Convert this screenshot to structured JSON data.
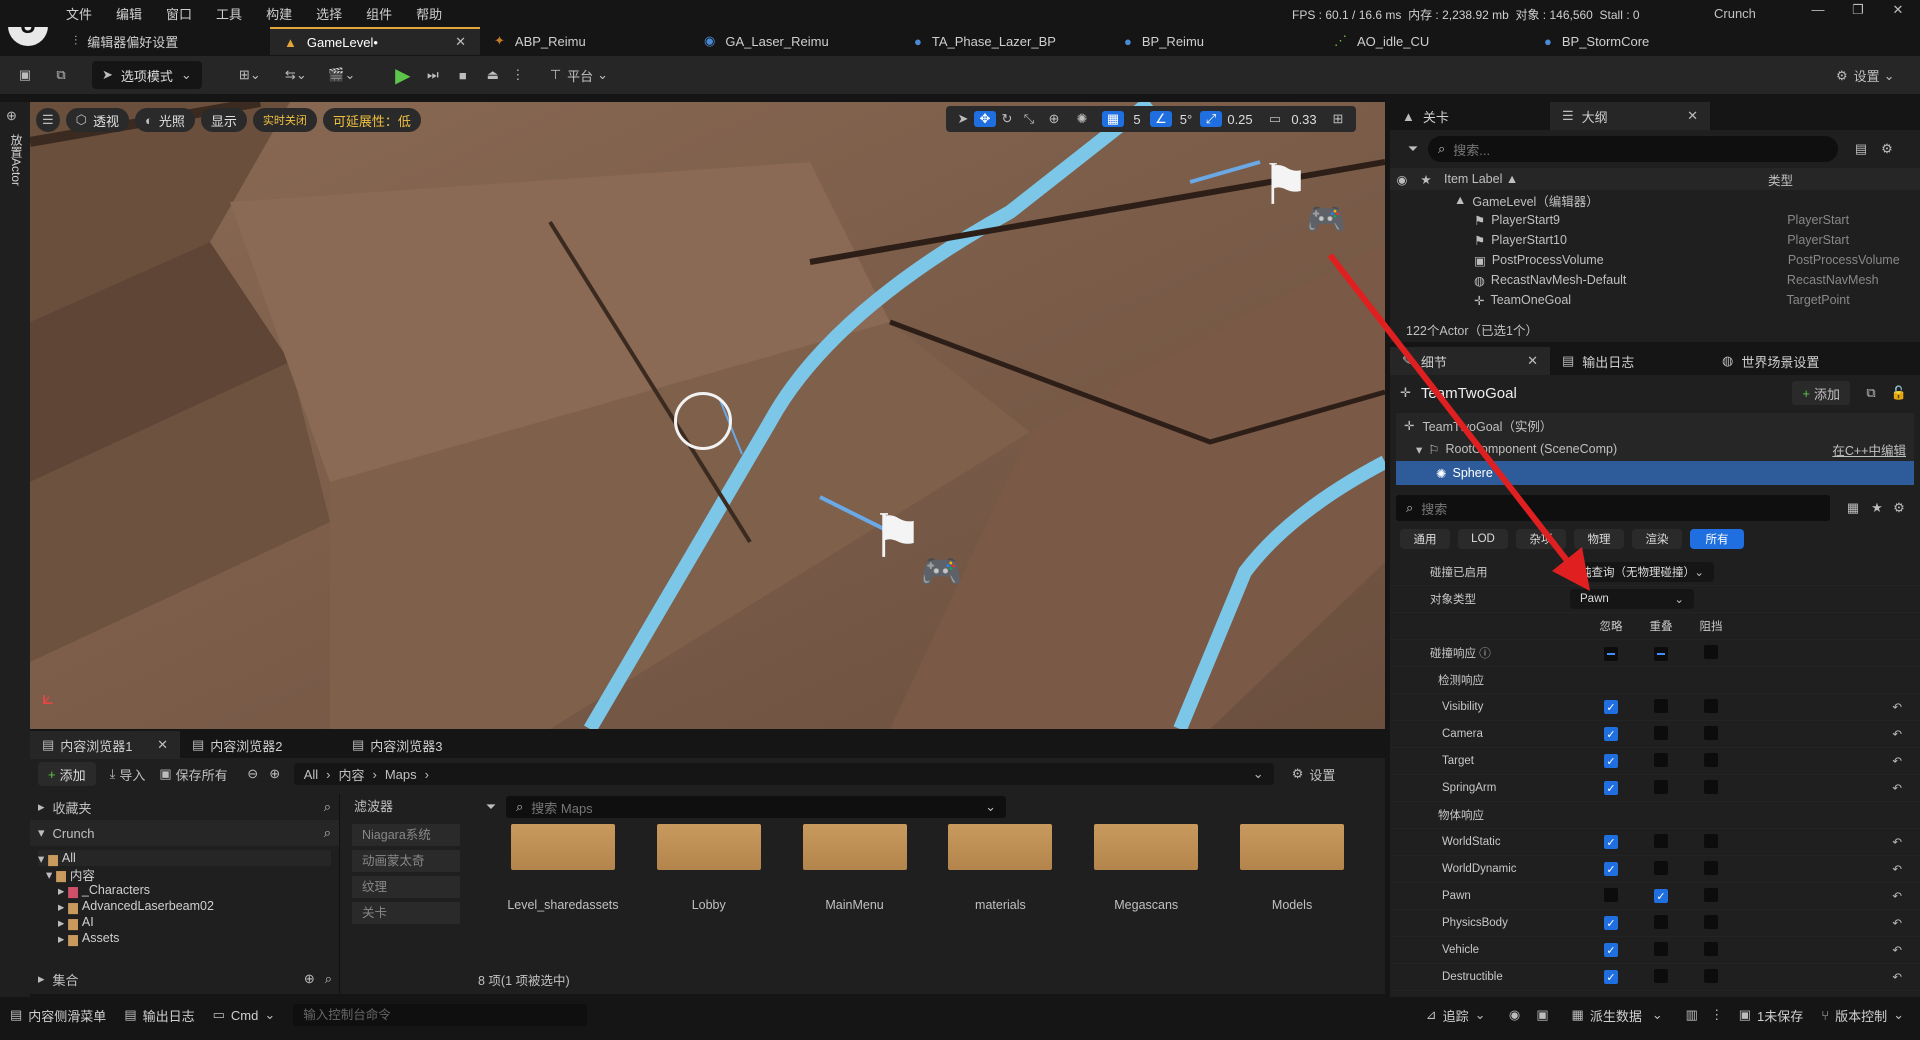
{
  "menu": [
    "文件",
    "编辑",
    "窗口",
    "工具",
    "构建",
    "选择",
    "组件",
    "帮助"
  ],
  "stats": {
    "fps": "FPS : 60.1",
    "ms": "/ 16.6 ms",
    "mem": "内存 : 2,238.92 mb",
    "objects": "对象 : 146,560",
    "stall": "Stall : 0",
    "project": "Crunch"
  },
  "tabs": [
    "编辑器偏好设置",
    "GameLevel•",
    "ABP_Reimu",
    "GA_Laser_Reimu",
    "TA_Phase_Lazer_BP",
    "BP_Reimu",
    "AO_idle_CU",
    "BP_StormCore"
  ],
  "toolbar": {
    "mode": "选项模式",
    "platform": "平台",
    "settings": "设置"
  },
  "viewport": {
    "perspective": "透视",
    "lighting": "光照",
    "show": "显示",
    "realtime": "实时关闭",
    "scalability": "可延展性：低",
    "grid": "5",
    "angle": "5°",
    "scale": "0.25",
    "camera": "0.33"
  },
  "leftstrip": "放置Actor",
  "outliner": {
    "tabs": [
      "关卡",
      "大纲"
    ],
    "search_placeholder": "搜索...",
    "col_label": "Item Label ▲",
    "col_type": "类型",
    "rows": [
      {
        "label": "GameLevel（编辑器）",
        "type": ""
      },
      {
        "label": "PlayerStart9",
        "type": "PlayerStart"
      },
      {
        "label": "PlayerStart10",
        "type": "PlayerStart"
      },
      {
        "label": "PostProcessVolume",
        "type": "PostProcessVolume"
      },
      {
        "label": "RecastNavMesh-Default",
        "type": "RecastNavMesh"
      },
      {
        "label": "TeamOneGoal",
        "type": "TargetPoint"
      }
    ],
    "footer": "122个Actor（已选1个）"
  },
  "details": {
    "tabs": [
      "细节",
      "输出日志",
      "世界场景设置"
    ],
    "actor": "TeamTwoGoal",
    "add": "添加",
    "tree": [
      "TeamTwoGoal（实例）",
      "RootComponent (SceneComp)",
      "Sphere"
    ],
    "edit_cpp": "在C++中编辑",
    "search": "搜索",
    "filters": [
      "通用",
      "LOD",
      "杂项",
      "物理",
      "渲染",
      "所有"
    ],
    "collision_enabled_label": "碰撞已启用",
    "collision_enabled_value": "纯查询（无物理碰撞）",
    "object_type_label": "对象类型",
    "object_type_value": "Pawn",
    "col_headers": [
      "忽略",
      "重叠",
      "阻挡"
    ],
    "response_label": "碰撞响应",
    "trace_label": "检测响应",
    "object_label": "物体响应",
    "traces": [
      {
        "name": "Visibility",
        "v": [
          1,
          0,
          0
        ]
      },
      {
        "name": "Camera",
        "v": [
          1,
          0,
          0
        ]
      },
      {
        "name": "Target",
        "v": [
          1,
          0,
          0
        ]
      },
      {
        "name": "SpringArm",
        "v": [
          1,
          0,
          0
        ]
      }
    ],
    "objects": [
      {
        "name": "WorldStatic",
        "v": [
          1,
          0,
          0
        ]
      },
      {
        "name": "WorldDynamic",
        "v": [
          1,
          0,
          0
        ]
      },
      {
        "name": "Pawn",
        "v": [
          0,
          1,
          0
        ]
      },
      {
        "name": "PhysicsBody",
        "v": [
          1,
          0,
          0
        ]
      },
      {
        "name": "Vehicle",
        "v": [
          1,
          0,
          0
        ]
      },
      {
        "name": "Destructible",
        "v": [
          1,
          0,
          0
        ]
      }
    ]
  },
  "content": {
    "tabs": [
      "内容浏览器1",
      "内容浏览器2",
      "内容浏览器3"
    ],
    "add": "添加",
    "import": "导入",
    "save_all": "保存所有",
    "path": [
      "All",
      "内容",
      "Maps"
    ],
    "settings": "设置",
    "favorites": "收藏夹",
    "project": "Crunch",
    "tree": [
      "All",
      "内容",
      "_Characters",
      "AdvancedLaserbeam02",
      "AI",
      "Assets"
    ],
    "collections": "集合",
    "filters_label": "滤波器",
    "filters": [
      "Niagara系统",
      "动画蒙太奇",
      "纹理",
      "关卡"
    ],
    "search_placeholder": "搜索 Maps",
    "folders": [
      "Level_sharedassets",
      "Lobby",
      "MainMenu",
      "materials",
      "Megascans",
      "Models"
    ],
    "status": "8 项(1 项被选中)"
  },
  "status": {
    "drawer": "内容侧滑菜单",
    "log": "输出日志",
    "cmd": "Cmd",
    "console_placeholder": "输入控制台命令",
    "trace": "追踪",
    "derived": "派生数据",
    "unsaved": "1未保存",
    "vcs": "版本控制"
  }
}
